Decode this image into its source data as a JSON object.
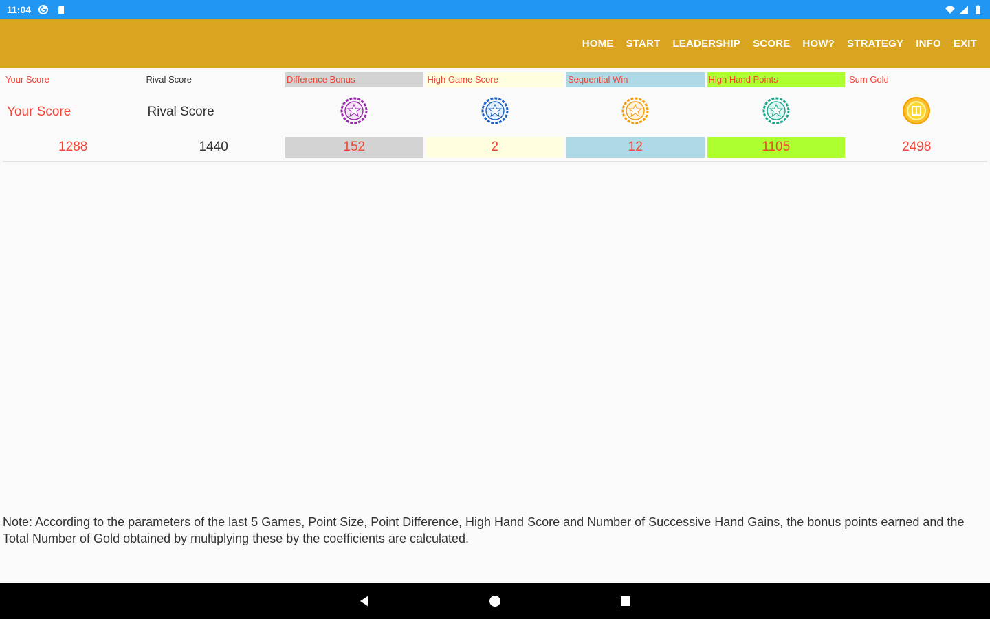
{
  "statusbar": {
    "time": "11:04",
    "icons": [
      "g-icon",
      "sd-card-icon"
    ],
    "right_icons": [
      "wifi-icon",
      "signal-icon",
      "battery-icon"
    ]
  },
  "appbar": {
    "menu": [
      "HOME",
      "START",
      "LEADERSHIP",
      "SCORE",
      "HOW?",
      "STRATEGY",
      "INFO",
      "EXIT"
    ],
    "bg": "#d9a521"
  },
  "table": {
    "headers": [
      {
        "label": "Your Score",
        "color": "#f44336",
        "bg": "transparent"
      },
      {
        "label": "Rival Score",
        "color": "#333333",
        "bg": "transparent"
      },
      {
        "label": "Difference Bonus",
        "color": "#f44336",
        "bg": "#d3d3d3"
      },
      {
        "label": "High Game Score",
        "color": "#f44336",
        "bg": "#ffffe0"
      },
      {
        "label": "Sequential Win",
        "color": "#f44336",
        "bg": "#add8e6"
      },
      {
        "label": "High Hand Points",
        "color": "#f44336",
        "bg": "#adff2f"
      },
      {
        "label": "Sum Gold",
        "color": "#f44336",
        "bg": "transparent"
      }
    ],
    "row2": {
      "your_label": "Your Score",
      "rival_label": "Rival Score",
      "icons": [
        {
          "name": "purple-star-chip-icon",
          "color": "#9c27b0"
        },
        {
          "name": "blue-star-chip-icon",
          "color": "#1e63c4"
        },
        {
          "name": "orange-star-chip-icon",
          "color": "#f39c12"
        },
        {
          "name": "teal-star-chip-icon",
          "color": "#1aa88f"
        },
        {
          "name": "gold-coin-icon",
          "color": "#f5b800"
        }
      ]
    },
    "values": [
      {
        "value": "1288",
        "color": "#f44336",
        "bg": "transparent"
      },
      {
        "value": "1440",
        "color": "#333333",
        "bg": "transparent"
      },
      {
        "value": "152",
        "color": "#f44336",
        "bg": "#d3d3d3"
      },
      {
        "value": "2",
        "color": "#f44336",
        "bg": "#ffffe0"
      },
      {
        "value": "12",
        "color": "#f44336",
        "bg": "#add8e6"
      },
      {
        "value": "1105",
        "color": "#f44336",
        "bg": "#adff2f"
      },
      {
        "value": "2498",
        "color": "#f44336",
        "bg": "transparent"
      }
    ]
  },
  "note": "Note: According to the parameters of the last 5 Games, Point Size, Point Difference, High Hand Score and Number of Successive Hand Gains, the bonus points earned and the Total Number of Gold obtained by multiplying these by the coefficients are calculated.",
  "navbar": {
    "buttons": [
      "back-button",
      "home-button",
      "recents-button"
    ]
  }
}
